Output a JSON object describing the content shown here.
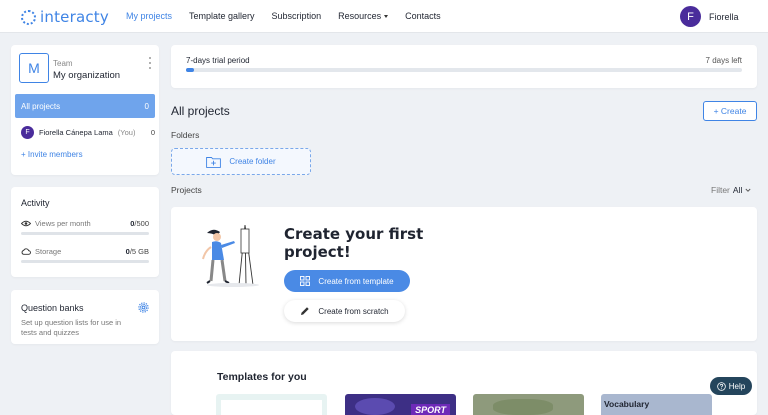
{
  "brand": {
    "name": "interacty",
    "accent": "#3f84e5"
  },
  "nav": {
    "items": [
      {
        "label": "My projects",
        "active": true
      },
      {
        "label": "Template gallery"
      },
      {
        "label": "Subscription"
      },
      {
        "label": "Resources",
        "dropdown": true
      },
      {
        "label": "Contacts"
      }
    ]
  },
  "user": {
    "initial": "F",
    "name": "Fiorella"
  },
  "team": {
    "logo_letter": "M",
    "label": "Team",
    "org_name": "My organization",
    "all_projects_label": "All projects",
    "all_projects_count": "0",
    "members": [
      {
        "initial": "F",
        "name": "Fiorella Cánepa Lama",
        "you": "(You)",
        "count": "0"
      }
    ],
    "invite_label": "+ Invite members"
  },
  "activity": {
    "title": "Activity",
    "views": {
      "label": "Views per month",
      "used": "0",
      "limit": "/500",
      "fraction": 0
    },
    "storage": {
      "label": "Storage",
      "used": "0",
      "limit": "/5 GB",
      "fraction": 0
    }
  },
  "question_banks": {
    "title": "Question banks",
    "description": "Set up question lists for use in tests and quizzes"
  },
  "trial": {
    "label": "7-days trial period",
    "remaining": "7 days left",
    "progress_fraction": 0.015
  },
  "main": {
    "title": "All projects",
    "create_label": "+ Create",
    "folders_label": "Folders",
    "create_folder_label": "Create folder",
    "projects_label": "Projects",
    "filter_label": "Filter",
    "filter_value": "All"
  },
  "empty_state": {
    "title": "Create your first project!",
    "template_button": "Create from template",
    "scratch_button": "Create from scratch"
  },
  "templates": {
    "title": "Templates for you",
    "thumbs": [
      {
        "text": ""
      },
      {
        "text": "SPORT"
      },
      {
        "text": ""
      },
      {
        "text": "Vocabulary"
      }
    ]
  },
  "help_label": "Help"
}
